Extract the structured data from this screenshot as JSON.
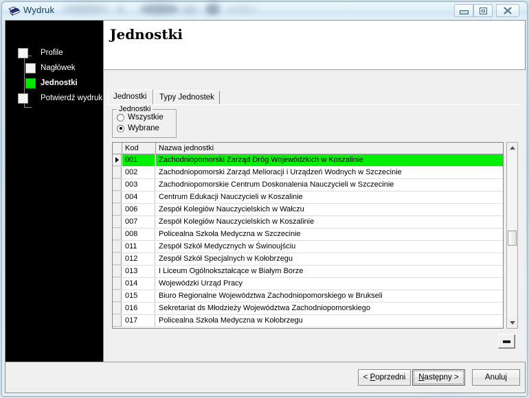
{
  "window": {
    "title": "Wydruk",
    "icon": "printer-icon",
    "controls": {
      "minimize": "minimize-button",
      "maximize": "restore-button",
      "close": "close-button"
    }
  },
  "wizard": {
    "steps": [
      {
        "label": "Profile",
        "state": "pending",
        "indent": 0
      },
      {
        "label": "Nagłówek",
        "state": "pending",
        "indent": 1
      },
      {
        "label": "Jednostki",
        "state": "current",
        "indent": 1
      },
      {
        "label": "Potwierdź wydruk",
        "state": "pending",
        "indent": 0
      }
    ]
  },
  "page": {
    "title": "Jednostki"
  },
  "tabs": [
    {
      "label": "Jednostki",
      "active": true
    },
    {
      "label": "Typy Jednostek",
      "active": false
    }
  ],
  "filter_group": {
    "legend": "Jednostki",
    "options": [
      {
        "label": "Wszystkie",
        "selected": false
      },
      {
        "label": "Wybrane",
        "selected": true
      }
    ]
  },
  "grid": {
    "columns": [
      "Kod",
      "Nazwa jednostki"
    ],
    "rows": [
      {
        "code": "001",
        "name": "Zachodniopomorski Zarząd Dróg Wojewódzkich w Koszalinie",
        "selected": true
      },
      {
        "code": "002",
        "name": "Zachodniopomorski Zarząd Melioracji i Urządzeń Wodnych w Szczecinie",
        "selected": false
      },
      {
        "code": "003",
        "name": "Zachodniopomorskie Centrum Doskonalenia Nauczycieli w Szczecinie",
        "selected": false
      },
      {
        "code": "004",
        "name": "Centrum Edukacji Nauczycieli w Koszalinie",
        "selected": false
      },
      {
        "code": "006",
        "name": "Zespół Kolegiów Nauczycielskich w Wałczu",
        "selected": false
      },
      {
        "code": "007",
        "name": "Zespół Kolegiów Nauczycielskich w Koszalinie",
        "selected": false
      },
      {
        "code": "008",
        "name": "Policealna Szkoła Medyczna w Szczecinie",
        "selected": false
      },
      {
        "code": "011",
        "name": "Zespół Szkół Medycznych w Świnoujściu",
        "selected": false
      },
      {
        "code": "012",
        "name": "Zespół Szkół Specjalnych w Kołobrzegu",
        "selected": false
      },
      {
        "code": "013",
        "name": "I Liceum Ogólnokształcące w Białym Borze",
        "selected": false
      },
      {
        "code": "014",
        "name": "Wojewódzki Urząd Pracy",
        "selected": false
      },
      {
        "code": "015",
        "name": "Biuro Regionalne Województwa Zachodniopomorskiego w Brukseli",
        "selected": false
      },
      {
        "code": "016",
        "name": "Sekretariat ds Młodzieży Województwa Zachodniopomorskiego",
        "selected": false
      },
      {
        "code": "017",
        "name": "Policealna Szkoła Medyczna w Kołobrzegu",
        "selected": false
      }
    ],
    "selection_color": "#00f000"
  },
  "mini_button": {
    "icon": "dash-icon"
  },
  "footer": {
    "buttons": [
      {
        "id": "prev",
        "prefix": "< ",
        "accel": "P",
        "rest": "oprzedni",
        "suffix": "",
        "focused": false
      },
      {
        "id": "next",
        "prefix": "",
        "accel": "N",
        "rest": "astępny",
        "suffix": " >",
        "focused": true
      },
      {
        "id": "cancel",
        "prefix": "",
        "accel": "",
        "rest": "Anuluj",
        "suffix": "",
        "focused": false
      }
    ]
  }
}
